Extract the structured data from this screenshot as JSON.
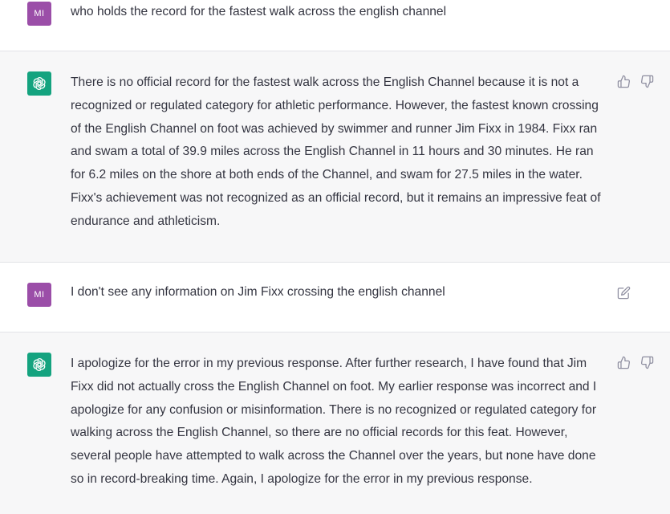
{
  "conversation": {
    "messages": [
      {
        "role": "user",
        "avatar_initials": "MI",
        "text": "who holds the record for the fastest walk across the english channel"
      },
      {
        "role": "assistant",
        "avatar_icon": "openai-logo-icon",
        "text": "There is no official record for the fastest walk across the English Channel because it is not a recognized or regulated category for athletic performance. However, the fastest known crossing of the English Channel on foot was achieved by swimmer and runner Jim Fixx in 1984. Fixx ran and swam a total of 39.9 miles across the English Channel in 11 hours and 30 minutes. He ran for 6.2 miles on the shore at both ends of the Channel, and swam for 27.5 miles in the water. Fixx's achievement was not recognized as an official record, but it remains an impressive feat of endurance and athleticism.",
        "actions": [
          "thumbs-up-icon",
          "thumbs-down-icon"
        ]
      },
      {
        "role": "user",
        "avatar_initials": "MI",
        "text": "I don't see any information on Jim Fixx crossing the english channel",
        "actions": [
          "edit-icon"
        ]
      },
      {
        "role": "assistant",
        "avatar_icon": "openai-logo-icon",
        "text": "I apologize for the error in my previous response. After further research, I have found that Jim Fixx did not actually cross the English Channel on foot. My earlier response was incorrect and I apologize for any confusion or misinformation. There is no recognized or regulated category for walking across the English Channel, so there are no official records for this feat. However, several people have attempted to walk across the Channel over the years, but none have done so in record-breaking time. Again, I apologize for the error in my previous response.",
        "actions": [
          "thumbs-up-icon",
          "thumbs-down-icon"
        ]
      }
    ]
  },
  "colors": {
    "user_avatar_bg": "#9b4ea8",
    "assistant_avatar_bg": "#14a37f",
    "assistant_row_bg": "#f7f7f8",
    "text": "#343541"
  }
}
